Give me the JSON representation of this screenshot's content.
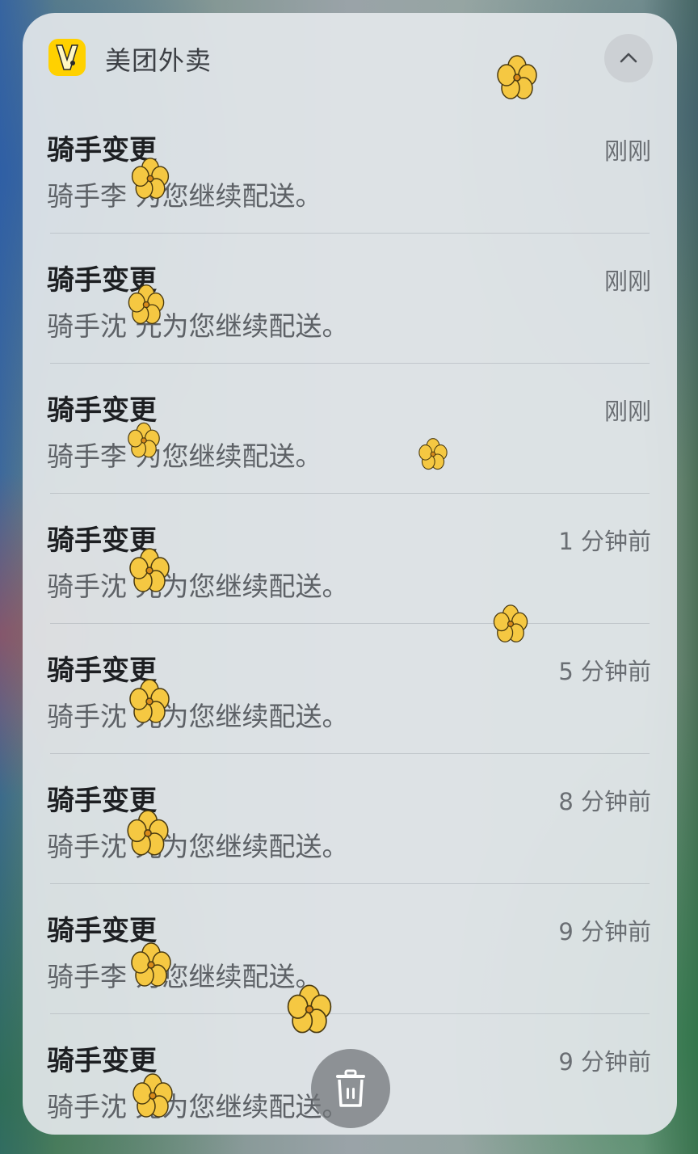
{
  "notification_group": {
    "app_name": "美团外卖",
    "app_icon": "meituan-waimai-logo",
    "collapse_icon": "chevron-up-icon",
    "items": [
      {
        "title": "骑手变更",
        "time": "刚刚",
        "body": "骑手李  为您继续配送。"
      },
      {
        "title": "骑手变更",
        "time": "刚刚",
        "body": "骑手沈  光为您继续配送。"
      },
      {
        "title": "骑手变更",
        "time": "刚刚",
        "body": "骑手李  为您继续配送。"
      },
      {
        "title": "骑手变更",
        "time": "1 分钟前",
        "body": "骑手沈  光为您继续配送。"
      },
      {
        "title": "骑手变更",
        "time": "5 分钟前",
        "body": "骑手沈  光为您继续配送。"
      },
      {
        "title": "骑手变更",
        "time": "8 分钟前",
        "body": "骑手沈  光为您继续配送。"
      },
      {
        "title": "骑手变更",
        "time": "9 分钟前",
        "body": "骑手李  为您继续配送。"
      },
      {
        "title": "骑手变更",
        "time": "9 分钟前",
        "body": "骑手沈  光为您继续配送。"
      }
    ]
  },
  "delete_button": {
    "icon": "trash-icon"
  },
  "colors": {
    "brand": "#ffd100",
    "flower": "#f5c842"
  }
}
